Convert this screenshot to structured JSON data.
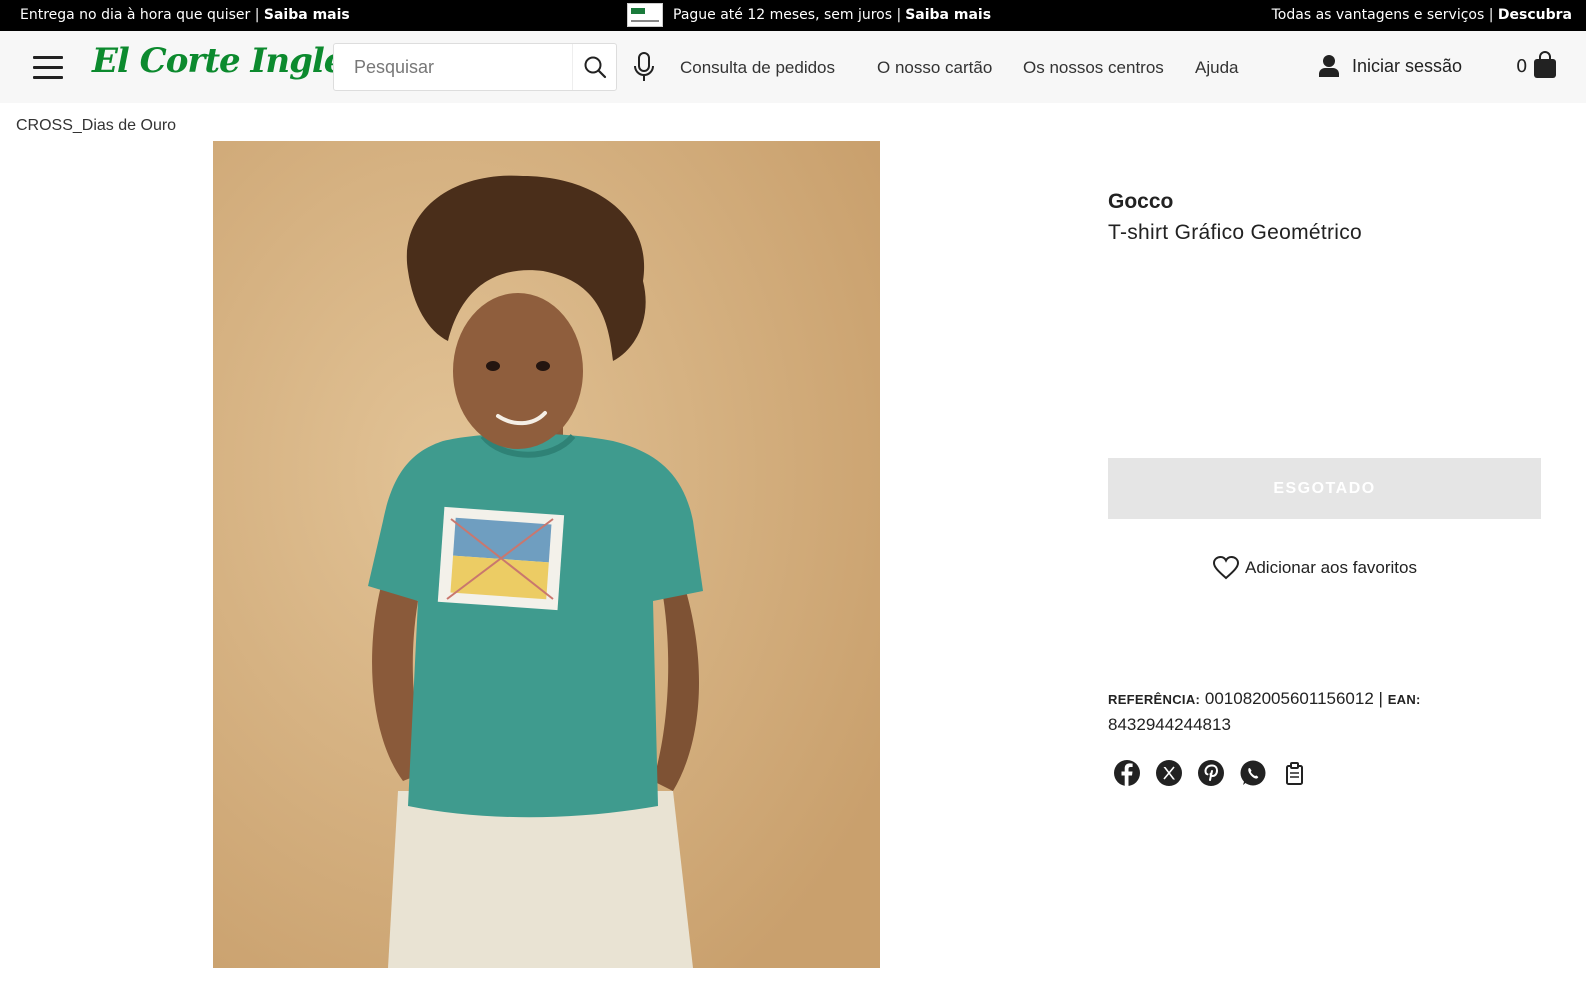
{
  "promo": {
    "left_text": "Entrega no dia à hora que quiser | ",
    "left_link": "Saiba mais",
    "center_text": "Pague até 12 meses, sem juros | ",
    "center_link": "Saiba mais",
    "right_text": "Todas as vantagens e serviços | ",
    "right_link": "Descubra"
  },
  "header": {
    "logo": "El Corte Inglés",
    "search_placeholder": "Pesquisar",
    "nav": [
      "Consulta de pedidos",
      "O nosso cartão",
      "Os nossos centros",
      "Ajuda"
    ],
    "login_label": "Iniciar sessão",
    "cart_count": "0"
  },
  "breadcrumb": "CROSS_Dias de Ouro",
  "product": {
    "brand": "Gocco",
    "name": "T-shirt Gráfico Geométrico",
    "soldout_label": "ESGOTADO",
    "favorite_label": "Adicionar aos favoritos",
    "reference_label": "REFERÊNCIA:",
    "reference_value": "001082005601156012",
    "separator": "|",
    "ean_label": "EAN:",
    "ean_value": "8432944244813"
  },
  "share_icons": [
    "facebook-icon",
    "x-icon",
    "pinterest-icon",
    "whatsapp-icon",
    "copy-icon"
  ],
  "colors": {
    "brand_green": "#0c8a2e",
    "shirt_teal": "#3f9b8e",
    "background_tan": "#d8b787"
  }
}
